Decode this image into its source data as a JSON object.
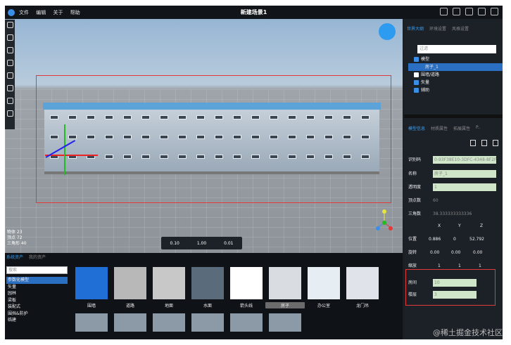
{
  "topbar": {
    "menu": [
      "文件",
      "编辑",
      "关于",
      "帮助"
    ],
    "title": "新建场景1"
  },
  "viewport": {
    "stats": [
      "物体 23",
      "顶点 72",
      "三角形 40"
    ],
    "transform": {
      "move": "0.10",
      "rotate": "1.00",
      "scale": "0.01"
    }
  },
  "assets": {
    "tabs": [
      "系统资产",
      "我的资产"
    ],
    "search_placeholder": "搜索",
    "categories": [
      "参数化模型",
      "矢量",
      "园林",
      "梁板",
      "装配式",
      "围挡&防护",
      "临建"
    ],
    "tiles": [
      "围墙",
      "道路",
      "地面",
      "水面",
      "箭头线",
      "房子",
      "办公室",
      "龙门吊"
    ]
  },
  "right": {
    "top_tabs": [
      "世界大纲",
      "环境设置",
      "风格设置"
    ],
    "filter_placeholder": "过滤",
    "tree": {
      "model": "模型",
      "house": "房子_1",
      "fence": "围墙/道路",
      "vector": "矢量",
      "aux": "辅助"
    },
    "prop_tabs": [
      "模型信息",
      "材质属性",
      "拓展属性",
      "P.."
    ],
    "props": {
      "id_label": "识别码",
      "id_val": "0-93F38E10-3DFC-4348-8F2F-...",
      "name_label": "名称",
      "name_val": "房子_1",
      "alpha_label": "透明度",
      "alpha_val": "1",
      "verts_label": "顶点数",
      "verts_val": "60",
      "tris_label": "三角数",
      "tris_val": "38.333333333336",
      "x": "X",
      "y": "Y",
      "z": "Z",
      "pos_label": "位置",
      "pos": [
        "0.886",
        "0",
        "52.792"
      ],
      "rot_label": "旋转",
      "rot": [
        "0.00",
        "0.00",
        "0.00"
      ],
      "scale_label": "缩放",
      "scale": [
        "1",
        "1",
        "1"
      ],
      "room_label": "房间",
      "room_val": "10",
      "floor_label": "楼层",
      "floor_val": "3"
    }
  },
  "watermark": "@稀土掘金技术社区"
}
